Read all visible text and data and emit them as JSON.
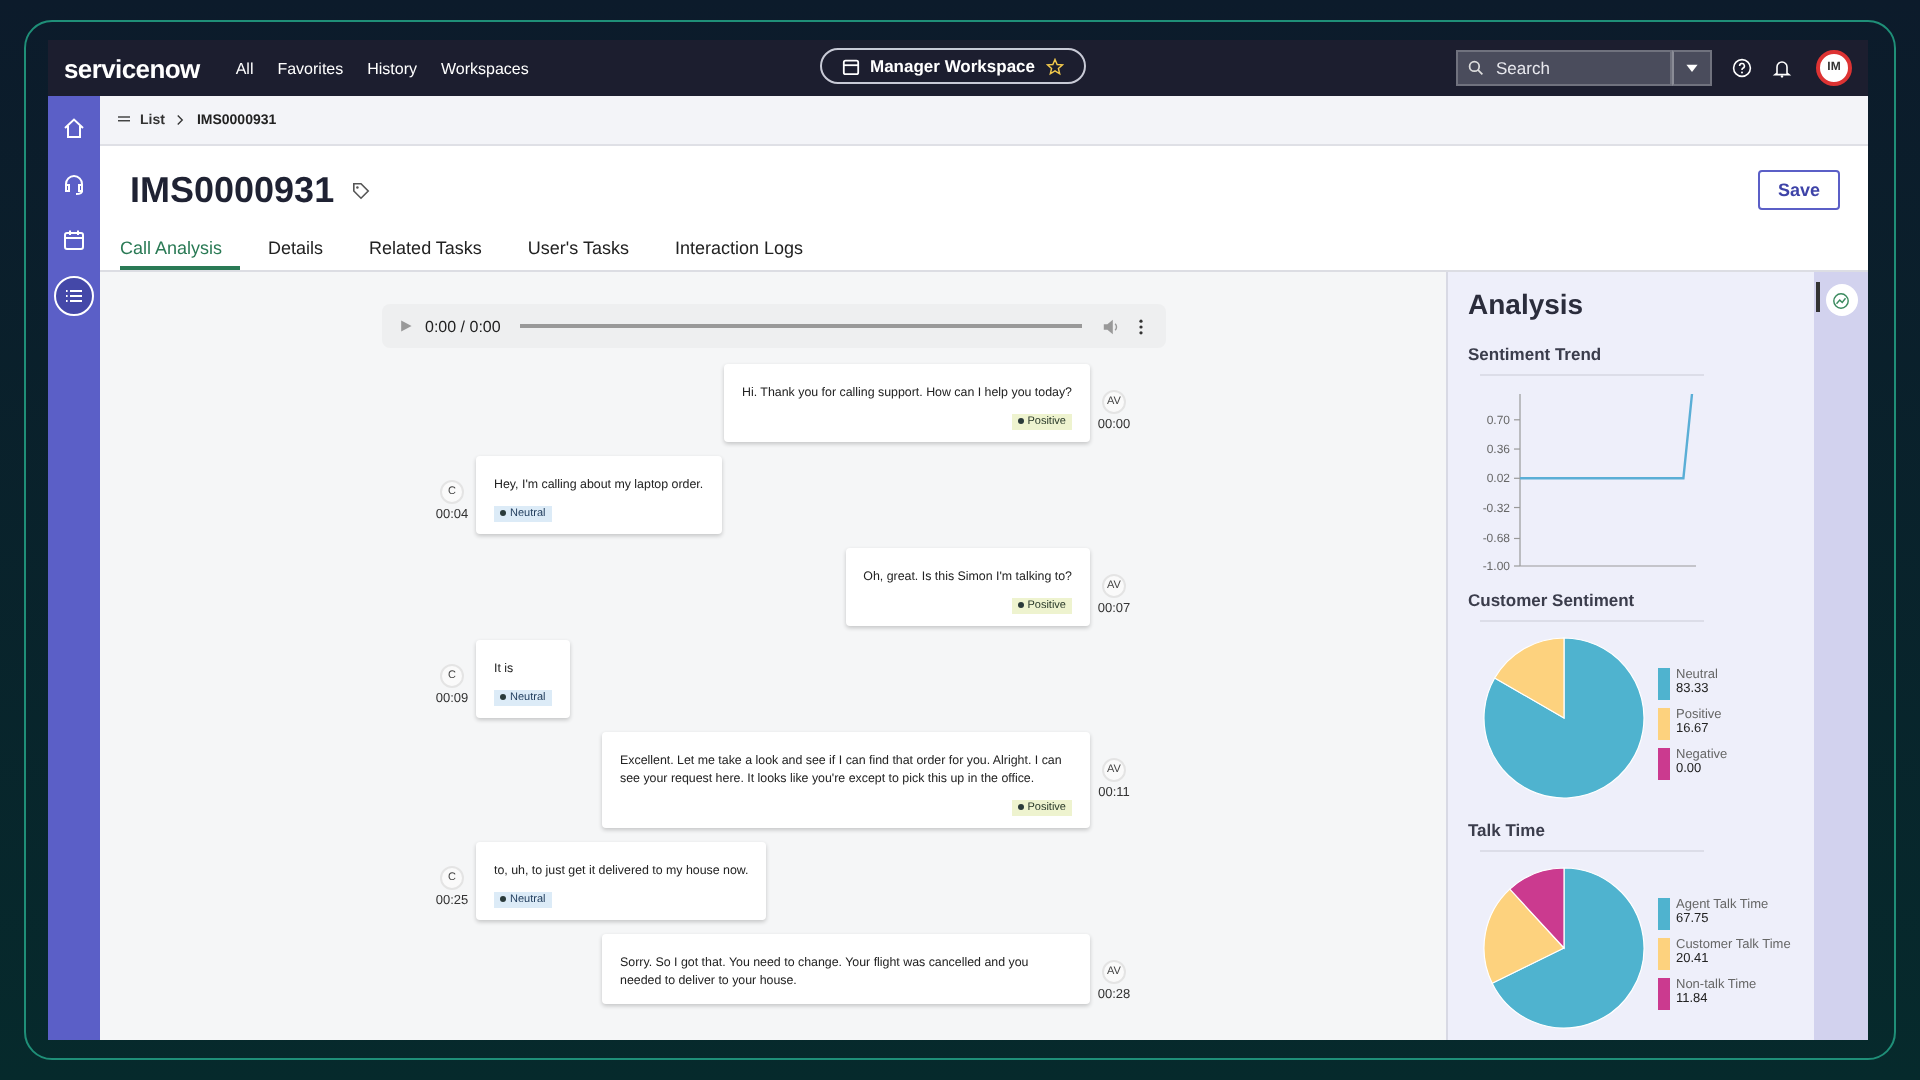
{
  "top_nav": {
    "logo": "servicenow",
    "links": [
      "All",
      "Favorites",
      "History",
      "Workspaces"
    ],
    "workspace": "Manager Workspace",
    "search": {
      "placeholder": "Search"
    },
    "avatar": "IM"
  },
  "sidebar": {
    "items": [
      {
        "kind": "home",
        "selected": false
      },
      {
        "kind": "headset",
        "selected": false
      },
      {
        "kind": "calendar",
        "selected": false
      },
      {
        "kind": "list",
        "selected": true
      }
    ]
  },
  "breadcrumb": {
    "parent": "List",
    "current": "IMS0000931"
  },
  "record": {
    "title": "IMS0000931",
    "save_button": "Save"
  },
  "tabs": [
    {
      "label": "Call Analysis",
      "selected": true
    },
    {
      "label": "Details",
      "selected": false
    },
    {
      "label": "Related Tasks",
      "selected": false
    },
    {
      "label": "User's Tasks",
      "selected": false
    },
    {
      "label": "Interaction Logs",
      "selected": false
    }
  ],
  "player": {
    "time": "0:00 / 0:00"
  },
  "messages": [
    {
      "kind": "agent",
      "speaker": "AV",
      "time": "00:00",
      "text": "Hi. Thank you for calling support. How can I help you today?",
      "tag": {
        "label": "Positive",
        "kind": "positive"
      }
    },
    {
      "kind": "customer",
      "speaker": "C",
      "time": "00:04",
      "text": "Hey, I'm calling about my laptop order.",
      "tag": {
        "label": "Neutral",
        "kind": "neutral"
      }
    },
    {
      "kind": "agent",
      "speaker": "AV",
      "time": "00:07",
      "text": "Oh, great. Is this Simon I'm talking to?",
      "tag": {
        "label": "Positive",
        "kind": "positive"
      }
    },
    {
      "kind": "customer",
      "speaker": "C",
      "time": "00:09",
      "text": "It is",
      "tag": {
        "label": "Neutral",
        "kind": "neutral"
      }
    },
    {
      "kind": "agent",
      "speaker": "AV",
      "time": "00:11",
      "text": "Excellent. Let me take a look and see if I can find that order for you. Alright. I can see your request here. It looks like you're except to pick this up in the office.",
      "tag": {
        "label": "Positive",
        "kind": "positive"
      }
    },
    {
      "kind": "customer",
      "speaker": "C",
      "time": "00:25",
      "text": "to, uh, to just get it delivered to my house now.",
      "tag": {
        "label": "Neutral",
        "kind": "neutral"
      }
    },
    {
      "kind": "agent",
      "speaker": "AV",
      "time": "00:28",
      "text": "Sorry. So I got that. You need to change. Your flight was cancelled and you needed to deliver to your house."
    }
  ],
  "analysis": {
    "title": "Analysis",
    "sentiment_trend": {
      "title": "Sentiment Trend",
      "chart_data": {
        "type": "line",
        "categories": [
          null,
          null,
          null,
          null,
          null,
          null,
          null,
          null,
          null,
          null,
          null,
          null,
          null,
          null,
          null,
          null,
          null,
          null,
          null,
          null,
          null
        ],
        "series": [
          {
            "color": "#5aaed6",
            "values": [
              0.02,
              0.02,
              0.02,
              0.02,
              0.02,
              0.02,
              0.02,
              0.02,
              0.02,
              0.02,
              0.02,
              0.02,
              0.02,
              0.02,
              0.02,
              0.02,
              0.02,
              0.02,
              0.02,
              0.02,
              1.0
            ]
          }
        ],
        "ylim": [
          -1,
          1
        ],
        "yticks": [
          {
            "value": 0.7,
            "label": "0.70"
          },
          {
            "value": 0.36,
            "label": "0.36"
          },
          {
            "value": 0.02,
            "label": "0.02"
          },
          {
            "value": -0.32,
            "label": "-0.32"
          },
          {
            "value": -0.68,
            "label": "-0.68"
          },
          {
            "value": -1,
            "label": "-1.00"
          }
        ]
      }
    },
    "customer_sentiment": {
      "title": "Customer Sentiment",
      "chart_data": {
        "type": "pie",
        "categories": [
          "Neutral",
          "Positive",
          "Negative"
        ],
        "values": [
          83.33,
          16.67,
          0.0
        ],
        "value_labels": [
          "83.33",
          "16.67",
          "0.00"
        ],
        "colors": [
          "#4fb3cf",
          "#fdd27e",
          "#cb3a8f"
        ]
      }
    },
    "talk_time": {
      "title": "Talk Time",
      "chart_data": {
        "type": "pie",
        "categories": [
          "Agent Talk Time",
          "Customer Talk Time",
          "Non-talk Time"
        ],
        "values": [
          67.75,
          20.41,
          11.84
        ],
        "value_labels": [
          "67.75",
          "20.41",
          "11.84"
        ],
        "colors": [
          "#4fb3cf",
          "#fdd27e",
          "#cb3a8f"
        ]
      }
    }
  }
}
